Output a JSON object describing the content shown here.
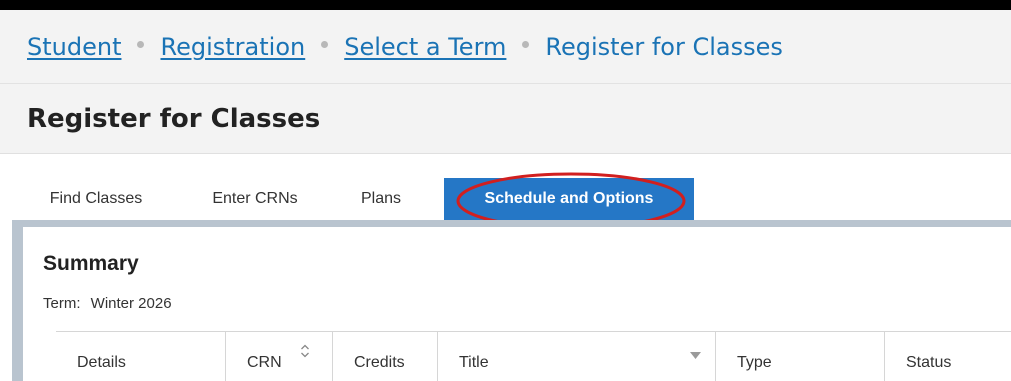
{
  "breadcrumb": {
    "items": [
      {
        "label": "Student"
      },
      {
        "label": "Registration"
      },
      {
        "label": "Select a Term"
      },
      {
        "label": "Register for Classes"
      }
    ]
  },
  "page": {
    "title": "Register for Classes"
  },
  "tabs": [
    {
      "label": "Find Classes"
    },
    {
      "label": "Enter CRNs"
    },
    {
      "label": "Plans"
    },
    {
      "label": "Schedule and Options",
      "active": true
    }
  ],
  "summary": {
    "title": "Summary",
    "term_label": "Term:",
    "term_value": "Winter 2026"
  },
  "table": {
    "columns": [
      {
        "label": "Details"
      },
      {
        "label": "CRN",
        "icon": "sort-icon"
      },
      {
        "label": "Credits"
      },
      {
        "label": "Title",
        "icon": "dropdown-caret-icon"
      },
      {
        "label": "Type"
      },
      {
        "label": "Status"
      }
    ]
  },
  "colors": {
    "link": "#1a73b5",
    "active_tab": "#2577c6",
    "annotation": "#d11f1f",
    "frame": "#b9c4cf"
  }
}
